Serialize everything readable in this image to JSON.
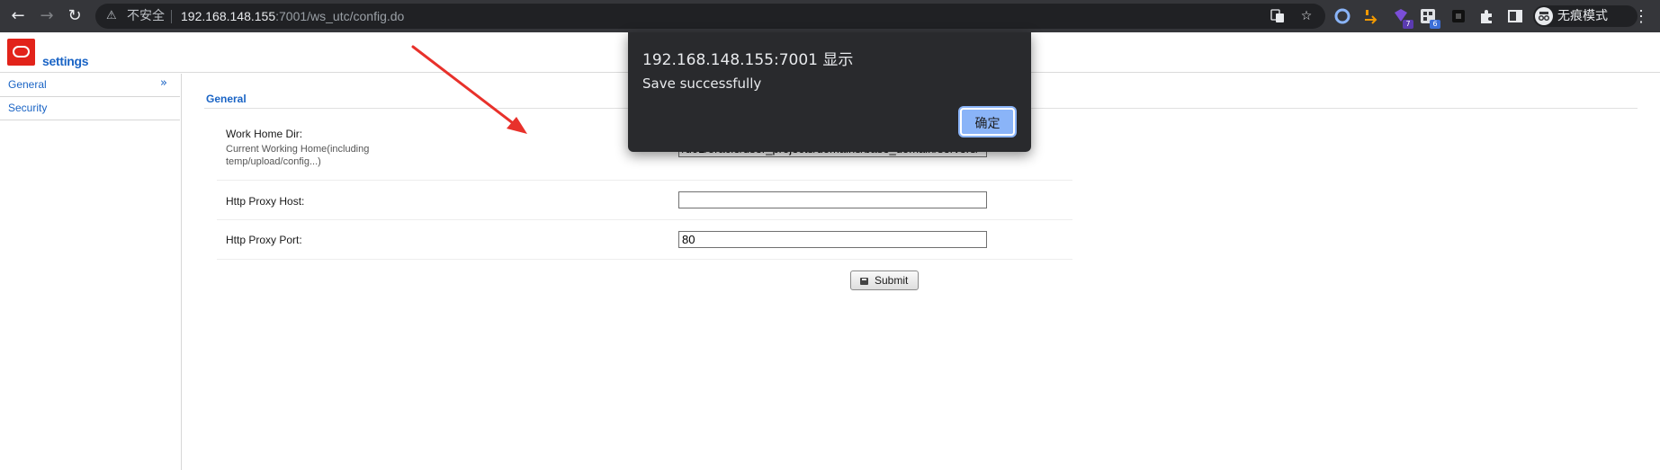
{
  "browser": {
    "insecure_label": "不安全",
    "url_host": "192.168.148.155",
    "url_path": ":7001/ws_utc/config.do",
    "incognito_label": "无痕模式",
    "extension_badges": [
      "7",
      "6"
    ]
  },
  "page": {
    "title": "settings",
    "nav": [
      {
        "label": "General"
      },
      {
        "label": "Security"
      }
    ],
    "section_title": "General",
    "rows": [
      {
        "label": "Work Home Dir:",
        "help": "Current Working Home(including temp/upload/config...)",
        "value": "/u01/oracle/user_projects/domains/base_domain/servers/"
      },
      {
        "label": "Http Proxy Host:",
        "value": ""
      },
      {
        "label": "Http Proxy Port:",
        "value": "80"
      }
    ],
    "submit_label": "Submit"
  },
  "dialog": {
    "title": "192.168.148.155:7001 显示",
    "message": "Save successfully",
    "ok_label": "确定"
  },
  "colors": {
    "link_blue": "#1a64c5",
    "oracle_red": "#e2231a",
    "toolbar": "#35363a",
    "dialog_bg": "#292a2d",
    "dialog_button": "#8ab4f8",
    "annotation_arrow": "#e8312b"
  }
}
